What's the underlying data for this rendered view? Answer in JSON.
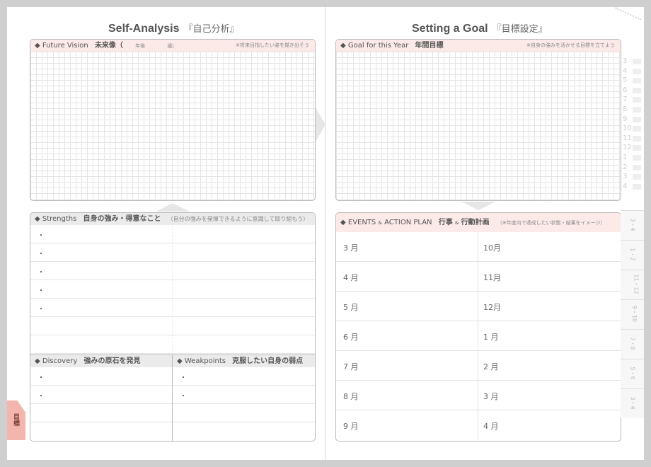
{
  "left_page": {
    "title": "Self-Analysis",
    "title_jp": "『自己分析』",
    "future_vision": {
      "label": "◆ Future Vision",
      "label_jp": "未来像（",
      "year": "年後",
      "age": "歳）",
      "note": "※将来目指したい姿を描き出そう"
    },
    "strengths": {
      "label": "◆ Strengths",
      "label_jp": "自身の強み・得意なこと",
      "note": "（自分の強みを発揮できるように意識して取り組もう）",
      "bullets": [
        "・",
        "・",
        "・",
        "・",
        "・",
        "",
        ""
      ]
    },
    "discovery": {
      "label": "◆ Discovery",
      "label_jp": "強みの原石を発見",
      "bullets": [
        "・",
        "・",
        "",
        ""
      ]
    },
    "weakpoints": {
      "label": "◆ Weakpoints",
      "label_jp": "克服したい自身の弱点",
      "bullets": [
        "・",
        "・",
        "",
        ""
      ]
    },
    "tab_label": "目標"
  },
  "right_page": {
    "title": "Setting a Goal",
    "title_jp": "『目標設定』",
    "goal_year": {
      "label": "◆ Goal for this Year",
      "label_jp": "年間目標",
      "note": "※自身の強みを活かせる目標を立てよう"
    },
    "events": {
      "label": "◆ EVENTS",
      "amp1": "&",
      "label2": "ACTION PLAN",
      "label_jp": "行事",
      "amp2": "&",
      "label_jp2": "行動計画",
      "note": "（※年度内で達成したい状態・結果をイメージ）",
      "rows": [
        {
          "left": "3 月",
          "right": "10月"
        },
        {
          "left": "4 月",
          "right": "11月"
        },
        {
          "left": "5 月",
          "right": "12月"
        },
        {
          "left": "6 月",
          "right": "1 月"
        },
        {
          "left": "7 月",
          "right": "2 月"
        },
        {
          "left": "8 月",
          "right": "3 月"
        },
        {
          "left": "9 月",
          "right": "4 月"
        }
      ]
    },
    "side_numbers": [
      "3",
      "4",
      "5",
      "6",
      "7",
      "8",
      "9",
      "10",
      "11",
      "12",
      "1",
      "2",
      "3",
      "4"
    ],
    "side_tabs": [
      "3・4",
      "1・2",
      "11・12",
      "9・10",
      "7・8",
      "5・6",
      "3・4"
    ]
  }
}
